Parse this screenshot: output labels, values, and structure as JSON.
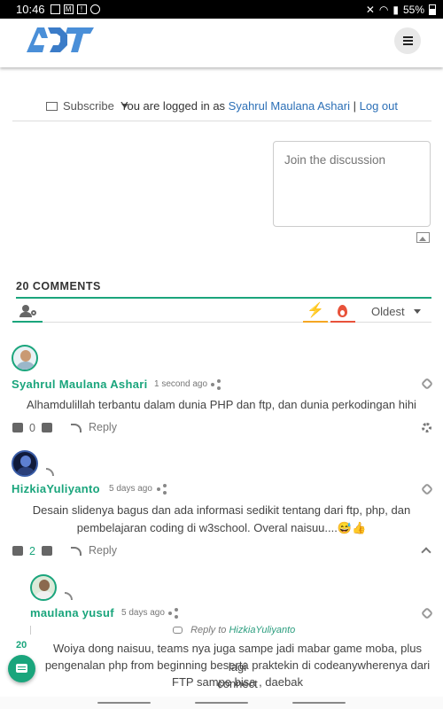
{
  "status_bar": {
    "time": "10:46",
    "battery": "55%"
  },
  "header": {
    "logo_text": "ADT"
  },
  "subscribe": {
    "label": "Subscribe",
    "logged_in_prefix": "You are logged in as",
    "user_name": "Syahrul Maulana Ashari",
    "separator": "|",
    "logout": "Log out"
  },
  "discussion": {
    "placeholder": "Join the discussion"
  },
  "comments_header": {
    "count_label": "20 COMMENTS",
    "sort_label": "Oldest"
  },
  "comments": [
    {
      "author": "Syahrul Maulana Ashari",
      "time": "1 second ago",
      "text": "Alhamdulillah terbantu dalam dunia PHP dan ftp, dan dunia perkodingan hihi",
      "votes": "0",
      "reply_label": "Reply"
    },
    {
      "author": "HizkiaYuliyanto",
      "time": "5 days ago",
      "text_line1": "Desain slidenya bagus dan ada informasi sedikit tentang dari ftp, php, dan",
      "text_line2": "pembelajaran coding di w3school. Overal naisuu....😅👍",
      "votes": "2",
      "reply_label": "Reply"
    },
    {
      "author": "maulana yusuf",
      "time": "5 days ago",
      "reply_to_prefix": "Reply to",
      "reply_to_name": "HizkiaYuliyanto",
      "text_line1": "Woiya dong naisuu, teams nya juga sampe jadi mabar game moba, plus lagi",
      "text_line2": "pengenalan php from beginning beserta praktekin di codeanywherenya dari connect",
      "text_line3": "FTP sampe bisa , daebak"
    }
  ],
  "side_count": "20",
  "colors": {
    "accent": "#1aa57c",
    "hot": "#f5a623",
    "popular": "#e8523a",
    "link": "#2b6fb6"
  }
}
